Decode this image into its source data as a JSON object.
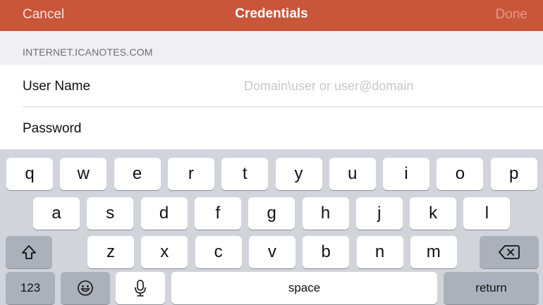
{
  "navbar": {
    "cancel_label": "Cancel",
    "title": "Credentials",
    "done_label": "Done"
  },
  "section": {
    "header": "INTERNET.ICANOTES.COM"
  },
  "form": {
    "user_label": "User Name",
    "user_placeholder": "Domain\\user or user@domain",
    "user_value": "",
    "password_label": "Password",
    "password_value": ""
  },
  "keyboard": {
    "row1": [
      "q",
      "w",
      "e",
      "r",
      "t",
      "y",
      "u",
      "i",
      "o",
      "p"
    ],
    "row2": [
      "a",
      "s",
      "d",
      "f",
      "g",
      "h",
      "j",
      "k",
      "l"
    ],
    "row3": [
      "z",
      "x",
      "c",
      "v",
      "b",
      "n",
      "m"
    ],
    "numbers_label": "123",
    "space_label": "space",
    "return_label": "return",
    "icons": {
      "shift": "shift-icon",
      "backspace": "backspace-icon",
      "emoji": "emoji-icon",
      "dictation": "microphone-icon"
    }
  },
  "colors": {
    "navbar": "#c9553a",
    "keyboard_bg": "#d1d4da",
    "special_key": "#abb1bb"
  }
}
